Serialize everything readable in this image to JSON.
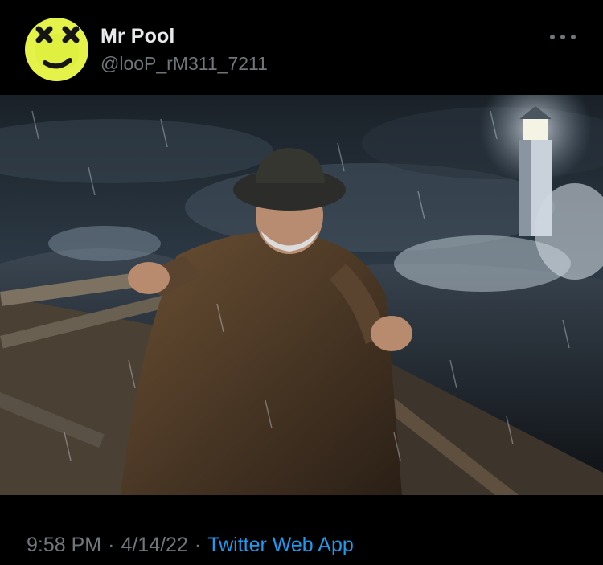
{
  "author": {
    "display_name": "Mr Pool",
    "handle": "@looP_rM311_7211",
    "avatar_icon": "yellow-smiley-crossed-eyes-icon"
  },
  "menu": {
    "icon": "more-dots-icon"
  },
  "media": {
    "kind": "photo",
    "subject": "old fisherman rowing a wooden boat in a storm with a lighthouse"
  },
  "meta": {
    "time": "9:58 PM",
    "separator": "·",
    "date": "4/14/22",
    "source": "Twitter Web App"
  },
  "colors": {
    "background": "#000000",
    "text_primary": "#e7e9ea",
    "text_secondary": "#71767b",
    "link": "#1d9bf0",
    "avatar_yellow": "#e5f24a"
  }
}
